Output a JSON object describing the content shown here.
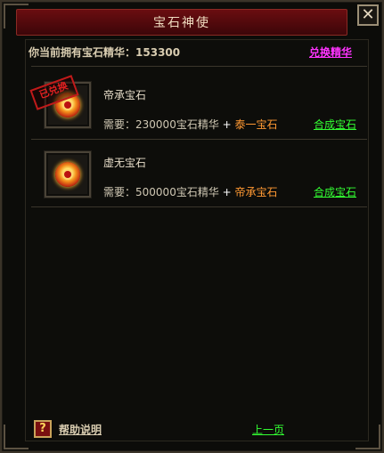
{
  "window": {
    "title": "宝石神使",
    "close_glyph": "✕"
  },
  "essence": {
    "label": "你当前拥有宝石精华：",
    "amount": "153300"
  },
  "exchange_label": "兑换精华",
  "gems": [
    {
      "name": "帝承宝石",
      "stamp": "已兑换",
      "require_prefix": "需要：",
      "require_amount": "230000宝石精华",
      "plus": "+",
      "require_gem": "泰一宝石",
      "action": "合成宝石"
    },
    {
      "name": "虚无宝石",
      "require_prefix": "需要：",
      "require_amount": "500000宝石精华",
      "plus": "+",
      "require_gem": "帝承宝石",
      "action": "合成宝石"
    }
  ],
  "footer": {
    "help_glyph": "?",
    "help_label": "帮助说明",
    "prev_label": "上一页"
  },
  "colors": {
    "title_bar": "#5a0a0c",
    "link_green": "#33ff33",
    "link_magenta": "#ff33ff",
    "requirement_orange": "#ff9933"
  },
  "icons": [
    "close-icon",
    "gem-icon",
    "help-icon"
  ]
}
